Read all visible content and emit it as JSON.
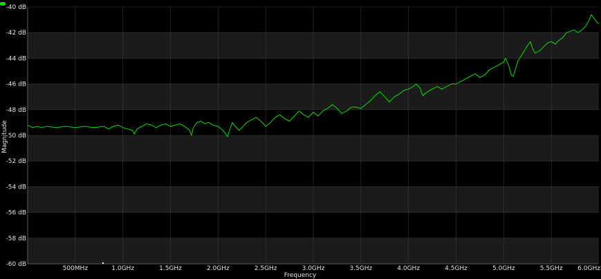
{
  "chart_data": {
    "type": "line",
    "xlabel": "Frequency",
    "ylabel": "Magnitude",
    "xlim_ghz": [
      0.0,
      6.0
    ],
    "ylim_db": [
      -60,
      -40
    ],
    "x_ticks": [
      {
        "v": 0.5,
        "label": "500MHz"
      },
      {
        "v": 1.0,
        "label": "1.0GHz"
      },
      {
        "v": 1.5,
        "label": "1.5GHz"
      },
      {
        "v": 2.0,
        "label": "2.0GHz"
      },
      {
        "v": 2.5,
        "label": "2.5GHz"
      },
      {
        "v": 3.0,
        "label": "3.0GHz"
      },
      {
        "v": 3.5,
        "label": "3.5GHz"
      },
      {
        "v": 4.0,
        "label": "4.0GHz"
      },
      {
        "v": 4.5,
        "label": "4.5GHz"
      },
      {
        "v": 5.0,
        "label": "5.0GHz"
      },
      {
        "v": 5.5,
        "label": "5.5GHz"
      },
      {
        "v": 6.0,
        "label": "6.0GHz"
      }
    ],
    "y_ticks": [
      {
        "v": -40,
        "label": "-40 dB"
      },
      {
        "v": -42,
        "label": "-42 dB"
      },
      {
        "v": -44,
        "label": "-44 dB"
      },
      {
        "v": -46,
        "label": "-46 dB"
      },
      {
        "v": -48,
        "label": "-48 dB"
      },
      {
        "v": -50,
        "label": "-50 dB"
      },
      {
        "v": -52,
        "label": "-52 dB"
      },
      {
        "v": -54,
        "label": "-54 dB"
      },
      {
        "v": -56,
        "label": "-56 dB"
      },
      {
        "v": -58,
        "label": "-58 dB"
      },
      {
        "v": -60,
        "label": "-60 dB"
      }
    ],
    "grid": true,
    "series": [
      {
        "color": "#00e000",
        "points": [
          [
            0.0,
            -49.2
          ],
          [
            0.05,
            -49.4
          ],
          [
            0.1,
            -49.3
          ],
          [
            0.15,
            -49.4
          ],
          [
            0.2,
            -49.3
          ],
          [
            0.3,
            -49.4
          ],
          [
            0.4,
            -49.3
          ],
          [
            0.5,
            -49.4
          ],
          [
            0.6,
            -49.3
          ],
          [
            0.7,
            -49.4
          ],
          [
            0.8,
            -49.3
          ],
          [
            0.85,
            -49.5
          ],
          [
            0.9,
            -49.3
          ],
          [
            0.95,
            -49.2
          ],
          [
            1.0,
            -49.4
          ],
          [
            1.05,
            -49.5
          ],
          [
            1.1,
            -49.6
          ],
          [
            1.12,
            -49.9
          ],
          [
            1.15,
            -49.5
          ],
          [
            1.2,
            -49.3
          ],
          [
            1.25,
            -49.1
          ],
          [
            1.3,
            -49.2
          ],
          [
            1.35,
            -49.4
          ],
          [
            1.4,
            -49.2
          ],
          [
            1.45,
            -49.1
          ],
          [
            1.5,
            -49.3
          ],
          [
            1.55,
            -49.2
          ],
          [
            1.6,
            -49.1
          ],
          [
            1.65,
            -49.3
          ],
          [
            1.7,
            -49.6
          ],
          [
            1.72,
            -50.0
          ],
          [
            1.74,
            -49.4
          ],
          [
            1.78,
            -49.0
          ],
          [
            1.82,
            -48.9
          ],
          [
            1.86,
            -49.1
          ],
          [
            1.9,
            -49.0
          ],
          [
            1.95,
            -49.2
          ],
          [
            2.0,
            -49.3
          ],
          [
            2.05,
            -49.6
          ],
          [
            2.08,
            -49.9
          ],
          [
            2.1,
            -50.1
          ],
          [
            2.12,
            -49.6
          ],
          [
            2.15,
            -49.0
          ],
          [
            2.18,
            -49.3
          ],
          [
            2.22,
            -49.6
          ],
          [
            2.25,
            -49.4
          ],
          [
            2.3,
            -49.0
          ],
          [
            2.35,
            -48.8
          ],
          [
            2.4,
            -48.6
          ],
          [
            2.45,
            -48.9
          ],
          [
            2.5,
            -49.3
          ],
          [
            2.55,
            -49.0
          ],
          [
            2.6,
            -48.6
          ],
          [
            2.65,
            -48.4
          ],
          [
            2.7,
            -48.7
          ],
          [
            2.75,
            -48.9
          ],
          [
            2.8,
            -48.5
          ],
          [
            2.85,
            -48.1
          ],
          [
            2.9,
            -48.4
          ],
          [
            2.95,
            -48.6
          ],
          [
            3.0,
            -48.2
          ],
          [
            3.05,
            -48.5
          ],
          [
            3.1,
            -48.1
          ],
          [
            3.15,
            -47.9
          ],
          [
            3.2,
            -47.6
          ],
          [
            3.25,
            -47.9
          ],
          [
            3.3,
            -48.3
          ],
          [
            3.35,
            -48.1
          ],
          [
            3.4,
            -47.8
          ],
          [
            3.45,
            -47.8
          ],
          [
            3.5,
            -47.9
          ],
          [
            3.55,
            -47.6
          ],
          [
            3.6,
            -47.3
          ],
          [
            3.65,
            -46.9
          ],
          [
            3.7,
            -46.6
          ],
          [
            3.75,
            -47.0
          ],
          [
            3.8,
            -47.4
          ],
          [
            3.85,
            -47.0
          ],
          [
            3.9,
            -46.8
          ],
          [
            3.95,
            -46.5
          ],
          [
            4.0,
            -46.4
          ],
          [
            4.05,
            -46.2
          ],
          [
            4.08,
            -46.0
          ],
          [
            4.12,
            -46.3
          ],
          [
            4.15,
            -46.9
          ],
          [
            4.2,
            -46.6
          ],
          [
            4.25,
            -46.4
          ],
          [
            4.3,
            -46.2
          ],
          [
            4.35,
            -46.4
          ],
          [
            4.4,
            -46.2
          ],
          [
            4.45,
            -46.0
          ],
          [
            4.5,
            -46.0
          ],
          [
            4.55,
            -45.8
          ],
          [
            4.6,
            -45.6
          ],
          [
            4.65,
            -45.4
          ],
          [
            4.7,
            -45.2
          ],
          [
            4.75,
            -45.5
          ],
          [
            4.8,
            -45.3
          ],
          [
            4.85,
            -44.9
          ],
          [
            4.9,
            -44.7
          ],
          [
            4.95,
            -44.5
          ],
          [
            5.0,
            -44.3
          ],
          [
            5.02,
            -44.0
          ],
          [
            5.05,
            -44.5
          ],
          [
            5.08,
            -45.3
          ],
          [
            5.1,
            -45.4
          ],
          [
            5.12,
            -44.9
          ],
          [
            5.15,
            -44.2
          ],
          [
            5.2,
            -43.6
          ],
          [
            5.25,
            -43.0
          ],
          [
            5.28,
            -42.7
          ],
          [
            5.3,
            -43.2
          ],
          [
            5.33,
            -43.6
          ],
          [
            5.38,
            -43.4
          ],
          [
            5.42,
            -43.1
          ],
          [
            5.46,
            -42.8
          ],
          [
            5.5,
            -42.7
          ],
          [
            5.54,
            -42.9
          ],
          [
            5.58,
            -42.6
          ],
          [
            5.62,
            -42.4
          ],
          [
            5.66,
            -42.0
          ],
          [
            5.7,
            -41.9
          ],
          [
            5.74,
            -41.8
          ],
          [
            5.78,
            -42.0
          ],
          [
            5.82,
            -41.8
          ],
          [
            5.86,
            -41.5
          ],
          [
            5.9,
            -41.0
          ],
          [
            5.92,
            -40.6
          ],
          [
            5.95,
            -40.9
          ],
          [
            5.98,
            -41.2
          ],
          [
            6.0,
            -41.3
          ]
        ]
      }
    ]
  },
  "colors": {
    "background": "#000000",
    "band": "#1b1b1b",
    "grid": "#3a3a3a",
    "trace": "#00e000",
    "text": "#e6e6e6"
  }
}
